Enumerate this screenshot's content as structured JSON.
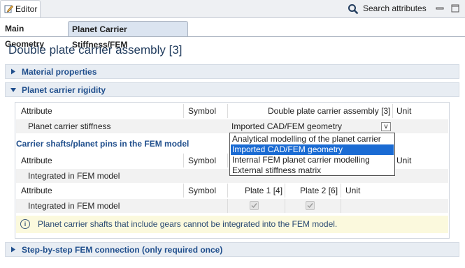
{
  "view": {
    "tab_label": "Editor",
    "search_label": "Search attributes"
  },
  "editor_tabs": [
    "Main Geometry",
    "Planet Carrier Stiffness/FEM"
  ],
  "title": "Double plate carrier assembly [3]",
  "sections": {
    "material": "Material properties",
    "rigidity": "Planet carrier rigidity",
    "step": "Step-by-step FEM connection (only required once)"
  },
  "table1": {
    "headers": {
      "attribute": "Attribute",
      "symbol": "Symbol",
      "value": "Double plate carrier assembly [3]",
      "unit": "Unit"
    },
    "row": {
      "label": "Planet carrier stiffness",
      "value": "Imported CAD/FEM geometry"
    },
    "combo_arrow": "v"
  },
  "dropdown": {
    "options": [
      "Analytical modelling of the planet carrier",
      "Imported CAD/FEM geometry",
      "Internal FEM planet carrier modelling",
      "External stiffness matrix"
    ],
    "selected_index": 1
  },
  "subsection": "Carrier shafts/planet pins in the FEM model",
  "table2": {
    "headers": {
      "attribute": "Attribute",
      "symbol": "Symbol",
      "unit": "Unit"
    },
    "row": {
      "label": "Integrated in FEM model"
    }
  },
  "table3": {
    "headers": {
      "attribute": "Attribute",
      "symbol": "Symbol",
      "plate1": "Plate 1 [4]",
      "plate2": "Plate 2 [6]",
      "unit": "Unit"
    },
    "row": {
      "label": "Integrated in FEM model"
    }
  },
  "info": {
    "icon": "i",
    "text": "Planet carrier shafts that include gears cannot be integrated into the FEM model."
  }
}
